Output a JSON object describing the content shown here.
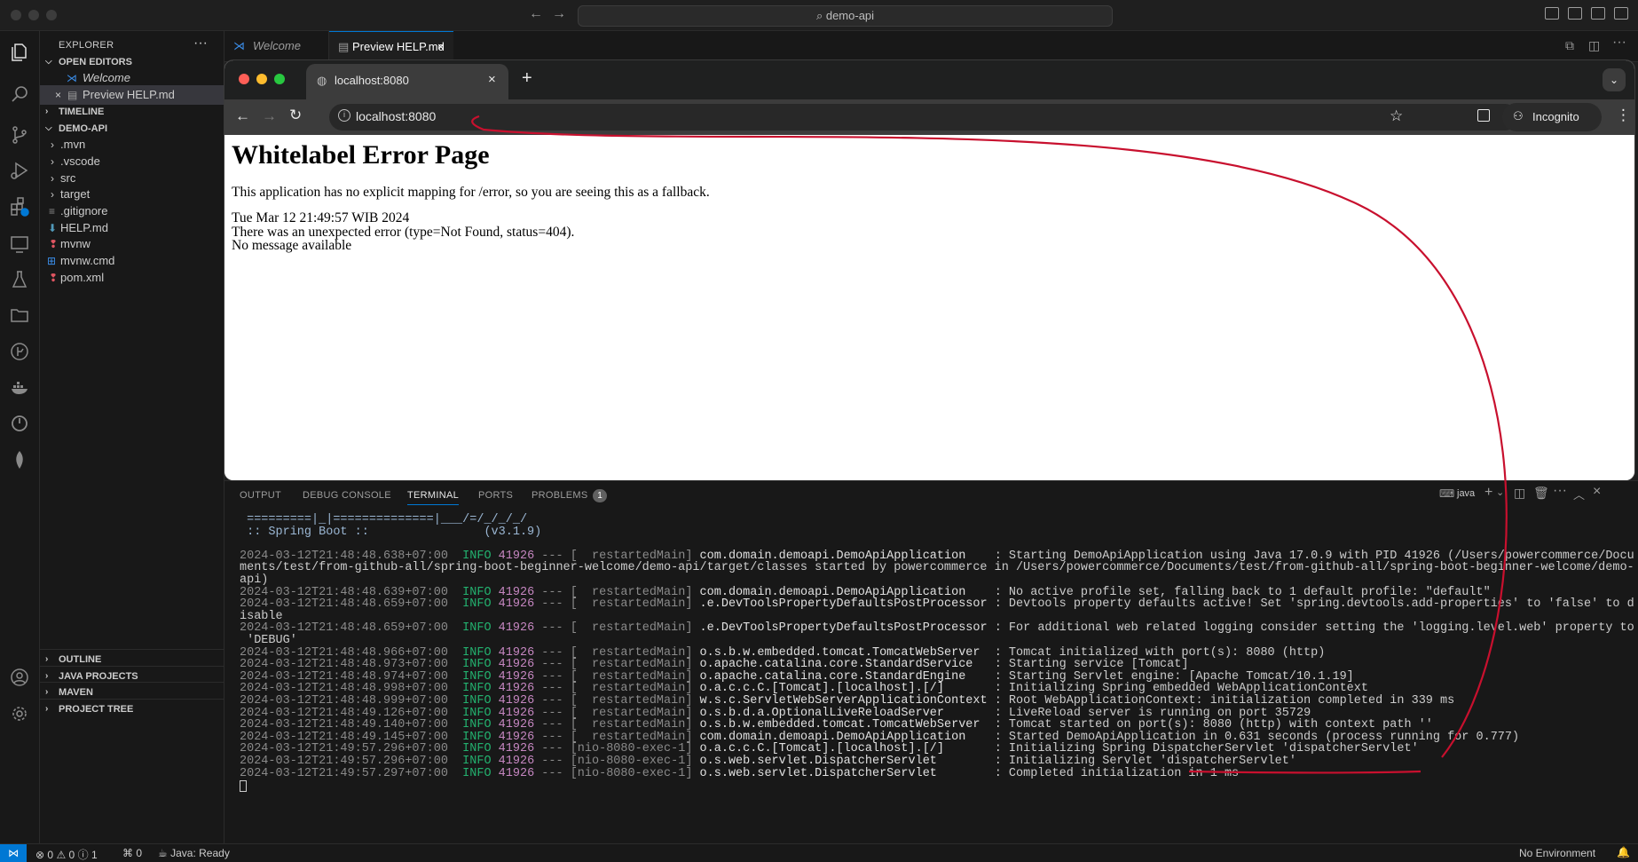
{
  "titlebar": {
    "search_text": "demo-api"
  },
  "sidebar": {
    "title": "EXPLORER",
    "open_editors_label": "OPEN EDITORS",
    "open_editors": [
      "Welcome",
      "Preview HELP.md"
    ],
    "timeline_label": "TIMELINE",
    "project_label": "DEMO-API",
    "folders": [
      ".mvn",
      ".vscode",
      "src",
      "target"
    ],
    "files": [
      ".gitignore",
      "HELP.md",
      "mvnw",
      "mvnw.cmd",
      "pom.xml"
    ],
    "bottom_sections": [
      "OUTLINE",
      "JAVA PROJECTS",
      "MAVEN",
      "PROJECT TREE"
    ]
  },
  "editor_tabs": [
    "Welcome",
    "Preview HELP.md"
  ],
  "browser": {
    "tab_title": "localhost:8080",
    "url": "localhost:8080",
    "incognito_label": "Incognito",
    "page": {
      "heading": "Whitelabel Error Page",
      "message": "This application has no explicit mapping for /error, so you are seeing this as a fallback.",
      "timestamp": "Tue Mar 12 21:49:57 WIB 2024",
      "error_line": "There was an unexpected error (type=Not Found, status=404).",
      "detail": "No message available"
    }
  },
  "panel": {
    "tabs": [
      "OUTPUT",
      "DEBUG CONSOLE",
      "TERMINAL",
      "PORTS",
      "PROBLEMS"
    ],
    "problems_count": "1",
    "shell_label": "java",
    "terminal_lines": [
      " =========|_|==============|___/=/_/_/_/",
      " :: Spring Boot ::                (v3.1.9)",
      "",
      "2024-03-12T21:48:48.638+07:00  INFO 41926 --- [  restartedMain] com.domain.demoapi.DemoApiApplication    : Starting DemoApiApplication using Java 17.0.9 with PID 41926 (/Users/powercommerce/Docu",
      "ments/test/from-github-all/spring-boot-beginner-welcome/demo-api/target/classes started by powercommerce in /Users/powercommerce/Documents/test/from-github-all/spring-boot-beginner-welcome/demo-",
      "api)",
      "2024-03-12T21:48:48.639+07:00  INFO 41926 --- [  restartedMain] com.domain.demoapi.DemoApiApplication    : No active profile set, falling back to 1 default profile: \"default\"",
      "2024-03-12T21:48:48.659+07:00  INFO 41926 --- [  restartedMain] .e.DevToolsPropertyDefaultsPostProcessor : Devtools property defaults active! Set 'spring.devtools.add-properties' to 'false' to d",
      "isable",
      "2024-03-12T21:48:48.659+07:00  INFO 41926 --- [  restartedMain] .e.DevToolsPropertyDefaultsPostProcessor : For additional web related logging consider setting the 'logging.level.web' property to",
      " 'DEBUG'",
      "2024-03-12T21:48:48.966+07:00  INFO 41926 --- [  restartedMain] o.s.b.w.embedded.tomcat.TomcatWebServer  : Tomcat initialized with port(s): 8080 (http)",
      "2024-03-12T21:48:48.973+07:00  INFO 41926 --- [  restartedMain] o.apache.catalina.core.StandardService   : Starting service [Tomcat]",
      "2024-03-12T21:48:48.974+07:00  INFO 41926 --- [  restartedMain] o.apache.catalina.core.StandardEngine    : Starting Servlet engine: [Apache Tomcat/10.1.19]",
      "2024-03-12T21:48:48.998+07:00  INFO 41926 --- [  restartedMain] o.a.c.c.C.[Tomcat].[localhost].[/]       : Initializing Spring embedded WebApplicationContext",
      "2024-03-12T21:48:48.999+07:00  INFO 41926 --- [  restartedMain] w.s.c.ServletWebServerApplicationContext : Root WebApplicationContext: initialization completed in 339 ms",
      "2024-03-12T21:48:49.126+07:00  INFO 41926 --- [  restartedMain] o.s.b.d.a.OptionalLiveReloadServer       : LiveReload server is running on port 35729",
      "2024-03-12T21:48:49.140+07:00  INFO 41926 --- [  restartedMain] o.s.b.w.embedded.tomcat.TomcatWebServer  : Tomcat started on port(s): 8080 (http) with context path ''",
      "2024-03-12T21:48:49.145+07:00  INFO 41926 --- [  restartedMain] com.domain.demoapi.DemoApiApplication    : Started DemoApiApplication in 0.631 seconds (process running for 0.777)",
      "2024-03-12T21:49:57.296+07:00  INFO 41926 --- [nio-8080-exec-1] o.a.c.c.C.[Tomcat].[localhost].[/]       : Initializing Spring DispatcherServlet 'dispatcherServlet'",
      "2024-03-12T21:49:57.296+07:00  INFO 41926 --- [nio-8080-exec-1] o.s.web.servlet.DispatcherServlet        : Initializing Servlet 'dispatcherServlet'",
      "2024-03-12T21:49:57.297+07:00  INFO 41926 --- [nio-8080-exec-1] o.s.web.servlet.DispatcherServlet        : Completed initialization in 1 ms"
    ]
  },
  "statusbar": {
    "problems": "0",
    "warnings": "0",
    "infos": "1",
    "ports": "0",
    "java_status": "Java: Ready",
    "environment": "No Environment"
  },
  "colors": {
    "annotation": "#c8102e",
    "accent": "#0078d4",
    "log_level": "#23b06e",
    "pid": "#c586c0"
  }
}
